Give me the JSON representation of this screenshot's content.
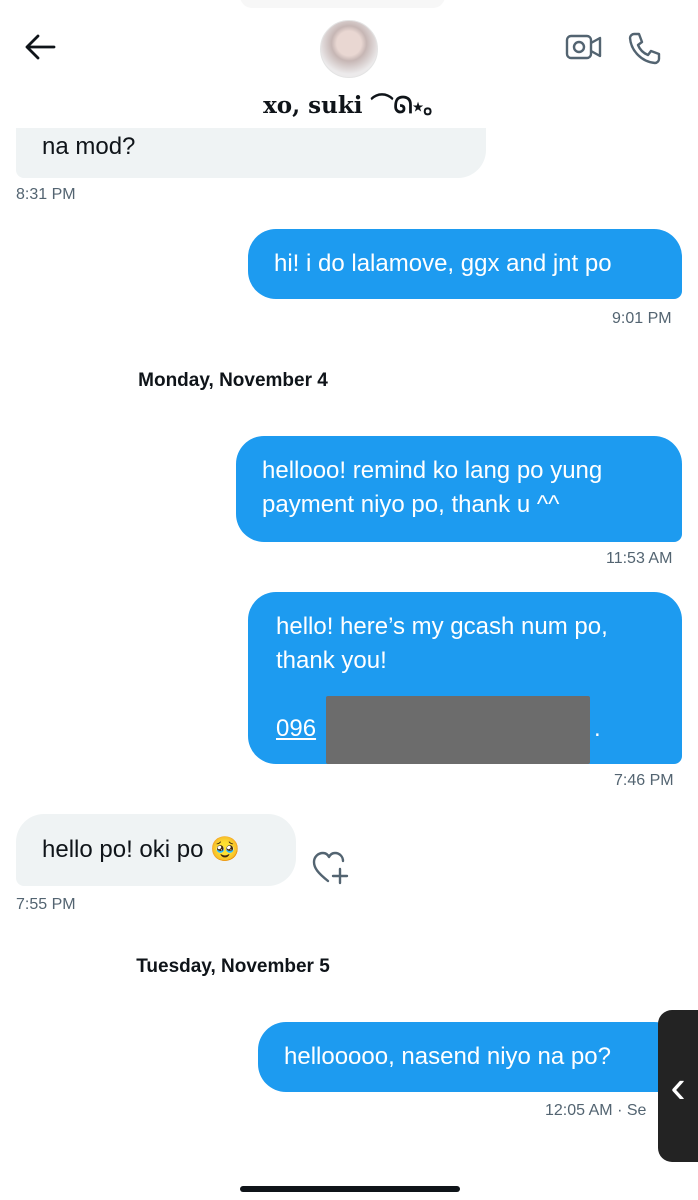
{
  "header": {
    "back_icon": "arrow-left-icon",
    "title": "xo, suki ⌒ᘏ⋆｡",
    "video_icon": "video-camera-icon",
    "phone_icon": "phone-icon"
  },
  "messages": [
    {
      "direction": "in",
      "text": "na mod?",
      "time": "8:31 PM"
    },
    {
      "direction": "out",
      "text": "hi! i do lalamove, ggx and jnt po",
      "time": "9:01 PM"
    },
    {
      "date_divider": "Monday, November 4"
    },
    {
      "direction": "out",
      "lines": [
        "hellooo! remind ko lang po yung",
        "payment niyo po, thank u ^^"
      ],
      "time": "11:53 AM"
    },
    {
      "direction": "out",
      "lines": [
        "hello! here’s my gcash num po,",
        "thank you!"
      ],
      "link_visible": "096",
      "link_tail": ".",
      "time": "7:46 PM"
    },
    {
      "direction": "in",
      "text": "hello po! oki po 🥹",
      "time": "7:55 PM"
    },
    {
      "date_divider": "Tuesday, November 5"
    },
    {
      "direction": "out",
      "text": "hellooooo, nasend niyo na po?",
      "time": "12:05 AM",
      "status": "· Se"
    }
  ],
  "react_icon": "heart-add-icon",
  "colors": {
    "accent": "#1d9bf0",
    "incoming_bubble": "#eff3f4",
    "muted_text": "#536471"
  }
}
